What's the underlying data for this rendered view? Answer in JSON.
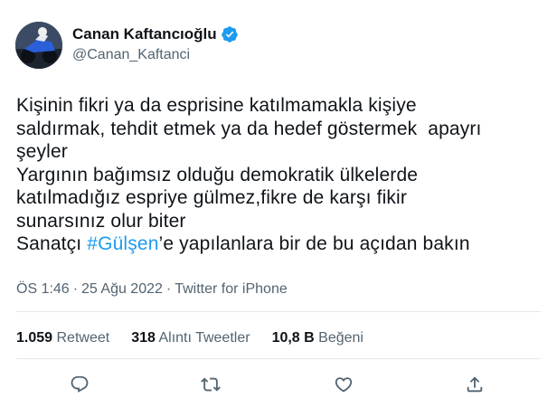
{
  "author": {
    "display_name": "Canan Kaftancıoğlu",
    "handle": "@Canan_Kaftanci",
    "verified": true,
    "avatar_icon": "avatar-photo-motorcycle"
  },
  "tweet": {
    "lines": [
      [
        {
          "text": "Kişinin fikri ya da esprisine katılmamakla kişiye"
        }
      ],
      [
        {
          "text": "saldırmak, tehdit etmek ya da hedef göstermek  apayrı"
        }
      ],
      [
        {
          "text": "şeyler"
        }
      ],
      [
        {
          "text": "Yargının bağımsız olduğu demokratik ülkelerde"
        }
      ],
      [
        {
          "text": "katılmadığız espriye gülmez,fikre de karşı fikir"
        }
      ],
      [
        {
          "text": "sunarsınız olur biter"
        }
      ],
      [
        {
          "text": "Sanatçı "
        },
        {
          "text": "#Gülşen",
          "hashtag": true
        },
        {
          "text": "’e yapılanlara bir de bu açıdan bakın"
        }
      ]
    ],
    "time": "ÖS 1:46",
    "separator": "·",
    "date": "25 Ağu 2022",
    "source": "Twitter for iPhone"
  },
  "stats": {
    "retweets_count": "1.059",
    "retweets_label": "Retweet",
    "quotes_count": "318",
    "quotes_label": "Alıntı Tweetler",
    "likes_count": "10,8 B",
    "likes_label": "Beğeni"
  },
  "actions": {
    "reply_icon": "reply-icon",
    "retweet_icon": "retweet-icon",
    "like_icon": "heart-icon",
    "share_icon": "share-icon"
  },
  "colors": {
    "hashtag": "#1d9bf0",
    "verified": "#1d9bf0",
    "secondary_text": "#536471"
  }
}
